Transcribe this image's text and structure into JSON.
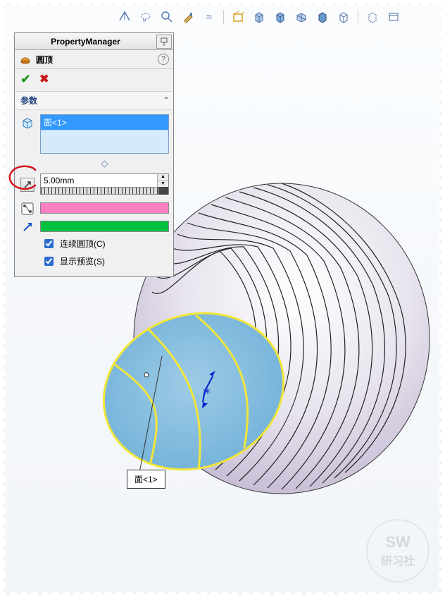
{
  "toolbar": {
    "icons": [
      "plane-icon",
      "lasso-icon",
      "magnify-icon",
      "brush-icon",
      "approx-icon",
      "sep",
      "draft-icon",
      "cube1-icon",
      "cube2-icon",
      "isometric-icon",
      "shaded-icon",
      "wireframe-icon",
      "sep",
      "hidden-icon",
      "window-icon"
    ]
  },
  "panel": {
    "title": "PropertyManager",
    "feature_name": "圆顶",
    "help": "?",
    "section": "参数",
    "face_item": "面<1>",
    "distance": "5.00mm",
    "cb_continuous": "连续圆顶(C)",
    "cb_preview": "显示预览(S)"
  },
  "callout": {
    "label": "面<1>"
  },
  "watermark": {
    "line1": "SW",
    "line2": "研习社"
  }
}
